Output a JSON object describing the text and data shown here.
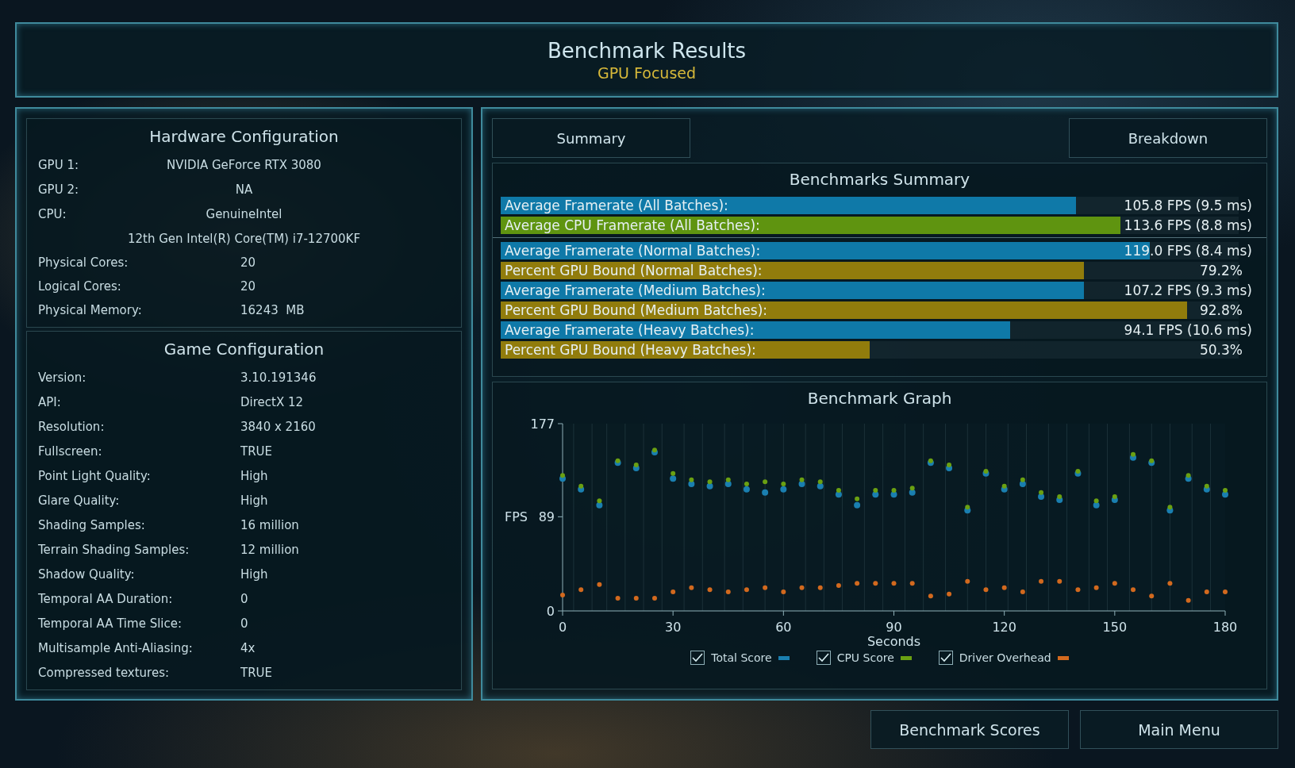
{
  "header": {
    "title": "Benchmark Results",
    "subtitle": "GPU Focused"
  },
  "hardware": {
    "title": "Hardware Configuration",
    "rows": [
      {
        "kind": "centered",
        "label": "GPU 1:",
        "value": "NVIDIA GeForce RTX 3080"
      },
      {
        "kind": "centered",
        "label": "GPU 2:",
        "value": "NA"
      },
      {
        "kind": "centered",
        "label": "CPU:",
        "value": "GenuineIntel"
      },
      {
        "kind": "centered",
        "value": "12th Gen Intel(R) Core(TM) i7-12700KF"
      },
      {
        "kind": "pair",
        "label": "Physical Cores:",
        "value": "20"
      },
      {
        "kind": "pair",
        "label": "Logical Cores:",
        "value": "20"
      },
      {
        "kind": "pair",
        "label": "Physical Memory:",
        "value": "16243  MB"
      }
    ]
  },
  "game": {
    "title": "Game Configuration",
    "rows": [
      {
        "label": "Version:",
        "value": "3.10.191346"
      },
      {
        "label": "API:",
        "value": "DirectX 12"
      },
      {
        "label": "Resolution:",
        "value": "3840 x 2160"
      },
      {
        "label": "Fullscreen:",
        "value": "TRUE"
      },
      {
        "label": "Point Light Quality:",
        "value": "High"
      },
      {
        "label": "Glare Quality:",
        "value": "High"
      },
      {
        "label": "Shading Samples:",
        "value": "16 million"
      },
      {
        "label": "Terrain Shading Samples:",
        "value": "12 million"
      },
      {
        "label": "Shadow Quality:",
        "value": "High"
      },
      {
        "label": "Temporal AA Duration:",
        "value": "0"
      },
      {
        "label": "Temporal AA Time Slice:",
        "value": "0"
      },
      {
        "label": "Multisample Anti-Aliasing:",
        "value": "4x"
      },
      {
        "label": "Compressed textures:",
        "value": "TRUE"
      }
    ]
  },
  "tabs": [
    {
      "label": "Summary"
    },
    {
      "label": "Breakdown"
    }
  ],
  "summary": {
    "title": "Benchmarks Summary",
    "rows": [
      {
        "kind": "fps",
        "label": "Average Framerate (All Batches):",
        "value": "105.8 FPS (9.5 ms)",
        "level": 0.78
      },
      {
        "kind": "cpu",
        "label": "Average CPU Framerate (All Batches):",
        "value": "113.6 FPS (8.8 ms)",
        "level": 0.84
      },
      {
        "kind": "fps",
        "label": "Average Framerate (Normal Batches):",
        "value": "119.0 FPS (8.4 ms)",
        "level": 0.88,
        "separator": true
      },
      {
        "kind": "percent",
        "label": "Percent GPU Bound (Normal Batches):",
        "value": "79.2%",
        "level": 0.79
      },
      {
        "kind": "fps",
        "label": "Average Framerate (Medium Batches):",
        "value": "107.2 FPS (9.3 ms)",
        "level": 0.79
      },
      {
        "kind": "percent",
        "label": "Percent GPU Bound (Medium Batches):",
        "value": "92.8%",
        "level": 0.93
      },
      {
        "kind": "fps",
        "label": "Average Framerate (Heavy Batches):",
        "value": "94.1 FPS (10.6 ms)",
        "level": 0.69
      },
      {
        "kind": "percent",
        "label": "Percent GPU Bound (Heavy Batches):",
        "value": "50.3%",
        "level": 0.5
      }
    ]
  },
  "graph": {
    "title": "Benchmark Graph",
    "legend": [
      {
        "checked": true
      },
      {
        "checked": true
      },
      {
        "checked": true
      }
    ],
    "chart_data": {
      "type": "scatter",
      "xlabel": "Seconds",
      "ylabel": "FPS",
      "xlim": [
        0,
        180
      ],
      "ylim": [
        0,
        177
      ],
      "xticks": [
        0,
        30,
        60,
        90,
        120,
        150,
        180
      ],
      "yticks": [
        0,
        89,
        177
      ],
      "ref_lines": [
        {
          "axis": "x",
          "value": 3
        },
        {
          "axis": "x",
          "value": 8
        },
        {
          "axis": "x",
          "value": 12
        },
        {
          "axis": "x",
          "value": 17
        },
        {
          "axis": "x",
          "value": 22
        },
        {
          "axis": "x",
          "value": 27
        },
        {
          "axis": "x",
          "value": 33
        },
        {
          "axis": "x",
          "value": 38
        },
        {
          "axis": "x",
          "value": 44
        },
        {
          "axis": "x",
          "value": 49
        },
        {
          "axis": "x",
          "value": 55
        },
        {
          "axis": "x",
          "value": 60
        },
        {
          "axis": "x",
          "value": 66
        },
        {
          "axis": "x",
          "value": 71
        },
        {
          "axis": "x",
          "value": 76
        },
        {
          "axis": "x",
          "value": 82
        },
        {
          "axis": "x",
          "value": 87
        },
        {
          "axis": "x",
          "value": 93
        },
        {
          "axis": "x",
          "value": 98
        },
        {
          "axis": "x",
          "value": 104
        },
        {
          "axis": "x",
          "value": 110
        },
        {
          "axis": "x",
          "value": 115
        },
        {
          "axis": "x",
          "value": 121
        },
        {
          "axis": "x",
          "value": 126
        },
        {
          "axis": "x",
          "value": 132
        },
        {
          "axis": "x",
          "value": 137
        },
        {
          "axis": "x",
          "value": 143
        },
        {
          "axis": "x",
          "value": 148
        },
        {
          "axis": "x",
          "value": 154
        },
        {
          "axis": "x",
          "value": 160
        },
        {
          "axis": "x",
          "value": 165
        },
        {
          "axis": "x",
          "value": 171
        },
        {
          "axis": "x",
          "value": 176
        }
      ],
      "x": [
        0,
        5,
        10,
        15,
        20,
        25,
        30,
        35,
        40,
        45,
        50,
        55,
        60,
        65,
        70,
        75,
        80,
        85,
        90,
        95,
        100,
        105,
        110,
        115,
        120,
        125,
        130,
        135,
        140,
        145,
        150,
        155,
        160,
        165,
        170,
        175,
        180
      ],
      "series": [
        {
          "name": "Total Score",
          "color": "#1a7fb0",
          "values": [
            125,
            115,
            100,
            140,
            135,
            150,
            125,
            120,
            118,
            120,
            115,
            112,
            115,
            120,
            118,
            110,
            100,
            110,
            110,
            112,
            140,
            135,
            95,
            130,
            115,
            120,
            108,
            105,
            130,
            100,
            105,
            145,
            140,
            95,
            125,
            115,
            110
          ]
        },
        {
          "name": "CPU Score",
          "color": "#6aa012",
          "values": [
            128,
            118,
            104,
            142,
            138,
            152,
            130,
            124,
            122,
            124,
            120,
            122,
            120,
            124,
            122,
            114,
            106,
            114,
            114,
            116,
            142,
            138,
            98,
            132,
            118,
            124,
            112,
            108,
            132,
            104,
            108,
            148,
            142,
            98,
            128,
            118,
            114
          ]
        },
        {
          "name": "Driver Overhead",
          "color": "#d2691e",
          "values": [
            15,
            20,
            25,
            12,
            12,
            12,
            18,
            22,
            20,
            18,
            20,
            22,
            18,
            22,
            22,
            24,
            26,
            26,
            26,
            26,
            14,
            16,
            28,
            20,
            22,
            18,
            28,
            28,
            20,
            22,
            26,
            20,
            14,
            26,
            10,
            18,
            18
          ]
        }
      ]
    }
  },
  "buttons": [
    "Benchmark Scores",
    "Main Menu"
  ]
}
